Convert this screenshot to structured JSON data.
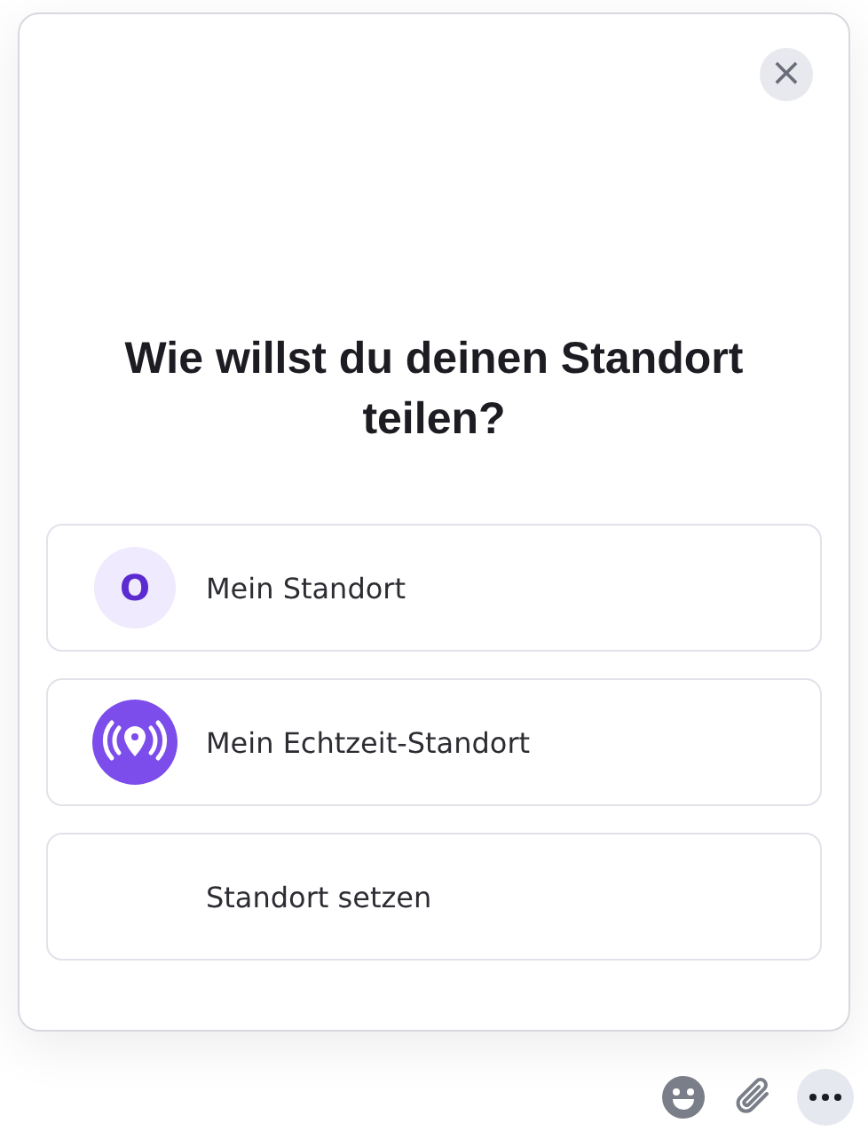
{
  "dialog": {
    "close_label": "×",
    "title": "Wie willst du deinen Standort teilen?",
    "options": [
      {
        "kind": "avatar",
        "avatar_text": "O",
        "label": "Mein Standort"
      },
      {
        "kind": "live",
        "label": "Mein Echtzeit-Standort"
      },
      {
        "kind": "none",
        "label": "Standort setzen"
      }
    ]
  },
  "toolbar": [
    {
      "kind": "emoji"
    },
    {
      "kind": "attach"
    },
    {
      "kind": "more"
    }
  ]
}
